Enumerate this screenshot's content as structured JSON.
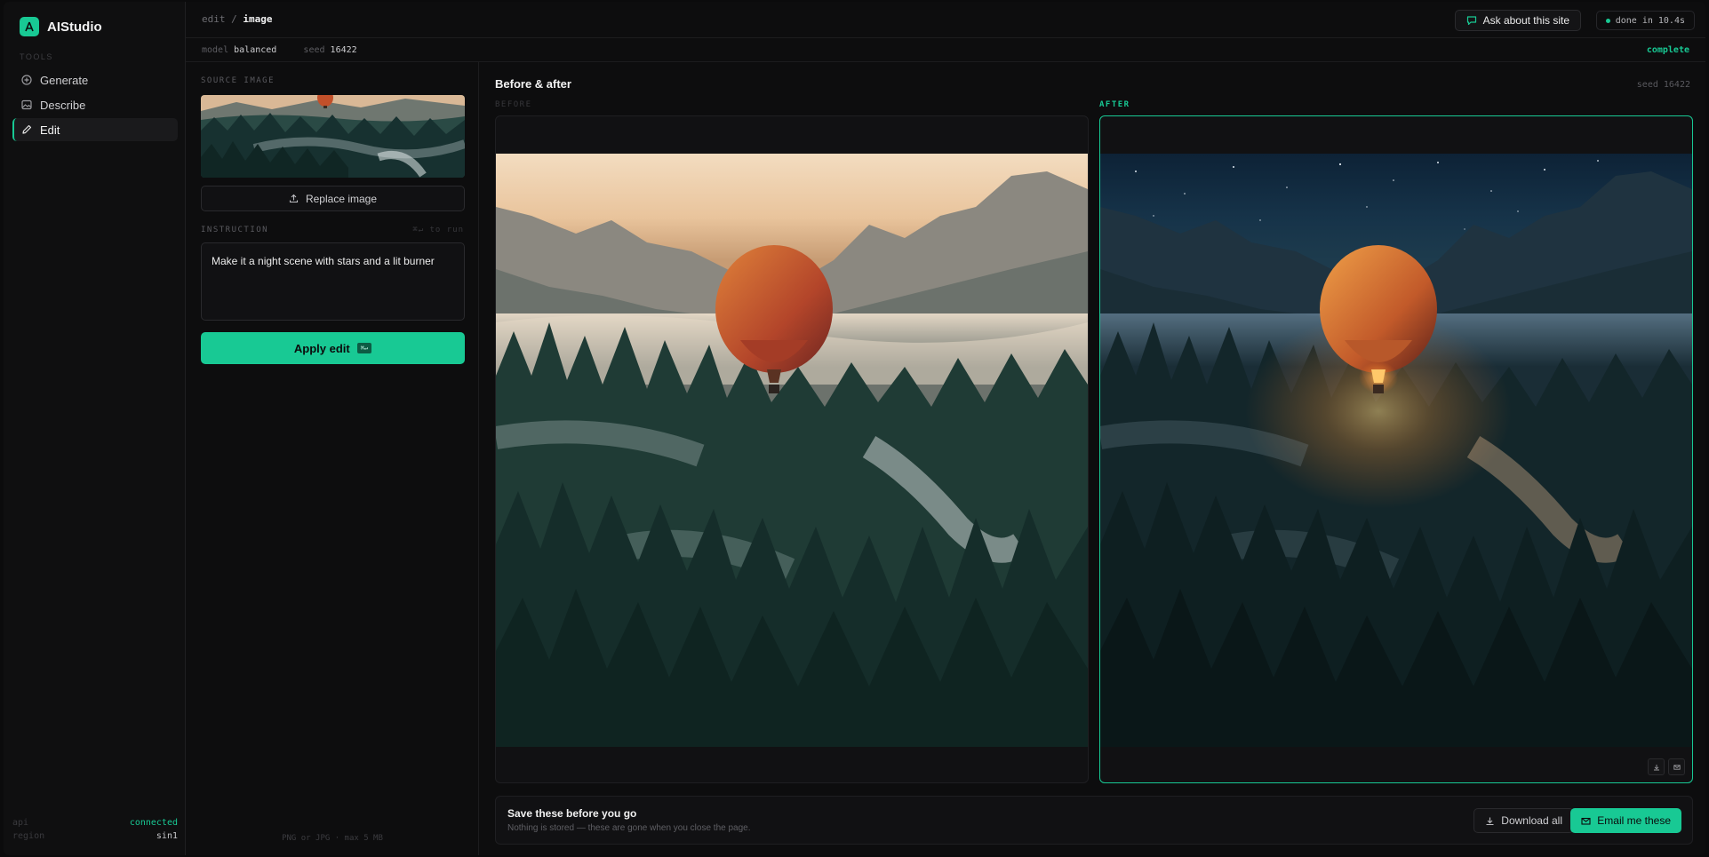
{
  "app": {
    "name": "AIStudio"
  },
  "sidebar": {
    "section_label": "TOOLS",
    "items": [
      {
        "label": "Generate",
        "icon": "plus-circle-icon"
      },
      {
        "label": "Describe",
        "icon": "image-icon"
      },
      {
        "label": "Edit",
        "icon": "pencil-icon",
        "active": true
      }
    ],
    "status": [
      {
        "key": "api",
        "value": "connected"
      },
      {
        "key": "region",
        "value": "sin1"
      }
    ]
  },
  "topbar": {
    "crumb_parent": "edit",
    "crumb_sep": "/",
    "crumb_current": "image",
    "ask_label": "Ask about this site",
    "done_label": "done in 10.4s"
  },
  "subbar": {
    "model_key": "model",
    "model_value": "balanced",
    "seed_key": "seed",
    "seed_value": "16422",
    "state": "complete"
  },
  "panel": {
    "source_label": "SOURCE IMAGE",
    "replace_label": "Replace image",
    "instruction_label": "INSTRUCTION",
    "instruction_hint": "⌘↵ to run",
    "instruction_value": "Make it a night scene with stars and a lit burner",
    "apply_label": "Apply edit",
    "apply_kbd": "⌘↵",
    "footer": "PNG or JPG · max 5 MB"
  },
  "main": {
    "title": "Before & after",
    "seed": "seed 16422",
    "before_label": "BEFORE",
    "after_label": "AFTER"
  },
  "save": {
    "title": "Save these before you go",
    "subtitle": "Nothing is stored — these are gone when you close the page.",
    "download_label": "Download all",
    "email_label": "Email me these"
  },
  "colors": {
    "accent": "#18c994",
    "background": "#0d0d0e"
  }
}
